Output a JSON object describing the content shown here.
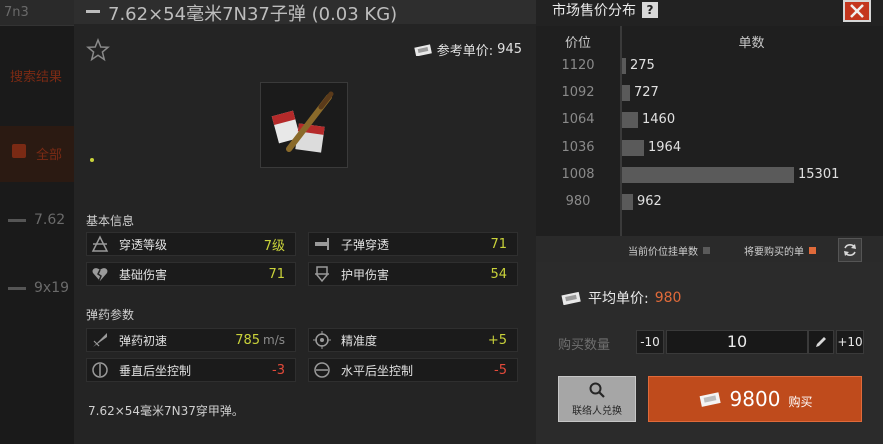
{
  "background": {
    "search_text": "7n3",
    "filter_label": "搜索结果",
    "all_tab_label": "全部",
    "list_items": [
      "7.62",
      "9x19"
    ]
  },
  "modal": {
    "title": "7.62×54毫米7N37子弹 (0.03 KG)",
    "favorite_icon": "star-icon",
    "reference_price_label": "参考单价:",
    "reference_price": "945",
    "item_image": "ammo-box-with-bullet",
    "basic_info_title": "基本信息",
    "basic_stats": [
      {
        "icon": "penetration-level-icon",
        "label": "穿透等级",
        "value": "7级",
        "color": "#c9d23a"
      },
      {
        "icon": "bullet-penetration-icon",
        "label": "子弹穿透",
        "value": "71",
        "color": "#c9d23a"
      },
      {
        "icon": "broken-heart-icon",
        "label": "基础伤害",
        "value": "71",
        "color": "#c9d23a"
      },
      {
        "icon": "armor-damage-icon",
        "label": "护甲伤害",
        "value": "54",
        "color": "#c9d23a"
      }
    ],
    "ammo_params_title": "弹药参数",
    "ammo_stats": [
      {
        "icon": "muzzle-velocity-icon",
        "label": "弹药初速",
        "value": "785",
        "unit": "m/s",
        "color": "#c9d23a"
      },
      {
        "icon": "crosshair-icon",
        "label": "精准度",
        "value": "+5",
        "unit": "",
        "color": "#c9d23a"
      },
      {
        "icon": "vertical-recoil-icon",
        "label": "垂直后坐控制",
        "value": "-3",
        "unit": "",
        "color": "#e44a3a"
      },
      {
        "icon": "horizontal-recoil-icon",
        "label": "水平后坐控制",
        "value": "-5",
        "unit": "",
        "color": "#e44a3a"
      }
    ],
    "description": "7.62×54毫米7N37穿甲弹。"
  },
  "market": {
    "title": "市场售价分布",
    "help_icon_text": "?",
    "col_price": "价位",
    "col_quantity": "单数",
    "price_ticks": [
      "1120",
      "1092",
      "1064",
      "1036",
      "1008",
      "980"
    ],
    "chart_data": {
      "type": "bar",
      "orientation": "horizontal",
      "bars": [
        {
          "value": 275
        },
        {
          "value": 727
        },
        {
          "value": 1460
        },
        {
          "value": 1964
        },
        {
          "value": 15301
        },
        {
          "value": 962
        }
      ],
      "y_ticks": [
        "1120",
        "1092",
        "1064",
        "1036",
        "1008",
        "980"
      ],
      "legend": [
        "当前价位挂单数",
        "将要购买的单"
      ],
      "legend_colors": [
        "#5a5a5a",
        "#e06a3a"
      ]
    },
    "legend_current": "当前价位挂单数",
    "legend_buy": "将要购买的单",
    "refresh_icon": "refresh-icon",
    "close_icon": "close-icon"
  },
  "purchase": {
    "avg_price_label": "平均单价:",
    "avg_price": "980",
    "quantity_label": "购买数量",
    "minus_label": "-10",
    "quantity": "10",
    "plus_label": "+10",
    "trader_label": "联络人兑换",
    "buy_total": "9800",
    "buy_label": "购买"
  },
  "colors": {
    "accent": "#bf4b1c",
    "positive": "#c9d23a",
    "negative": "#e44a3a"
  }
}
